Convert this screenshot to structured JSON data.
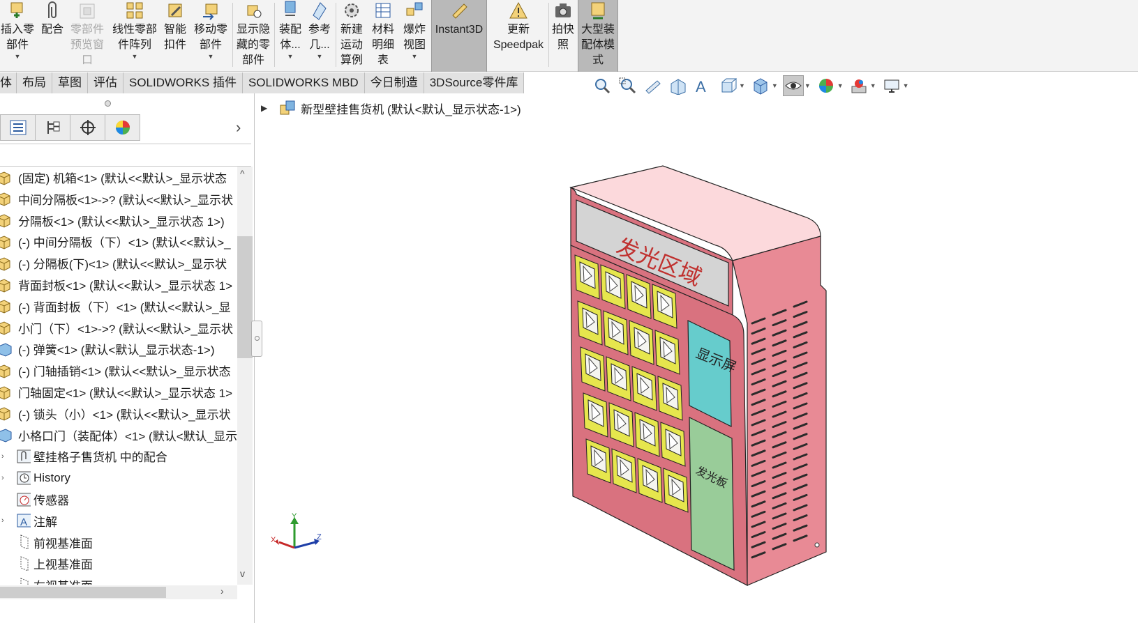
{
  "ribbon": {
    "insert_component": "插入零\n部件",
    "mate": "配合",
    "component_preview": "零部件\n预览窗\n口",
    "linear_pattern": "线性零部\n件阵列",
    "smart_fasteners": "智能\n扣件",
    "move_component": "移动零\n部件",
    "show_hidden": "显示隐\n藏的零\n部件",
    "assembly_features": "装配\n体...",
    "reference_geometry": "参考\n几...",
    "new_motion_study": "新建\n运动\n算例",
    "bill_of_materials": "材料\n明细\n表",
    "exploded_view": "爆炸\n视图",
    "instant3d": "Instant3D",
    "update_speedpak": "更新\nSpeedpak",
    "take_snapshot": "拍快\n照",
    "large_assembly_mode": "大型装\n配体模\n式"
  },
  "tabs": [
    "体",
    "布局",
    "草图",
    "评估",
    "SOLIDWORKS 插件",
    "SOLIDWORKS MBD",
    "今日制造",
    "3DSource零件库"
  ],
  "tree": {
    "components": [
      "(固定) 机箱<1> (默认<<默认>_显示状态",
      "中间分隔板<1>->? (默认<<默认>_显示状",
      "分隔板<1> (默认<<默认>_显示状态 1>)",
      "(-) 中间分隔板（下）<1> (默认<<默认>_",
      "(-) 分隔板(下)<1> (默认<<默认>_显示状",
      "背面封板<1> (默认<<默认>_显示状态 1>",
      "(-) 背面封板（下）<1> (默认<<默认>_显",
      "小门（下）<1>->? (默认<<默认>_显示状",
      "(-) 弹簧<1> (默认<默认_显示状态-1>)",
      "(-) 门轴插销<1> (默认<<默认>_显示状态",
      "门轴固定<1> (默认<<默认>_显示状态 1>",
      "(-) 锁头（小）<1> (默认<<默认>_显示状",
      "小格口门（装配体）<1> (默认<默认_显示"
    ],
    "folders": [
      "壁挂格子售货机 中的配合",
      "History",
      "传感器",
      "注解",
      "前视基准面",
      "上视基准面",
      "右视基准面"
    ]
  },
  "graphics": {
    "root_node": "新型壁挂售货机  (默认<默认_显示状态-1>)",
    "glow_area_label": "发光区域",
    "display_screen_label": "显示屏",
    "glow_panel_label": "发光板",
    "triad": {
      "x": "X",
      "y": "Y",
      "z": "Z"
    }
  },
  "colors": {
    "cabinet_front": "#d9727f",
    "cabinet_top": "#fcd9dc",
    "cabinet_side": "#e88a95",
    "glow_area": "#d4d4d4",
    "screen": "#66cccc",
    "glow_panel": "#99cc99",
    "door": "#e6e64d"
  }
}
